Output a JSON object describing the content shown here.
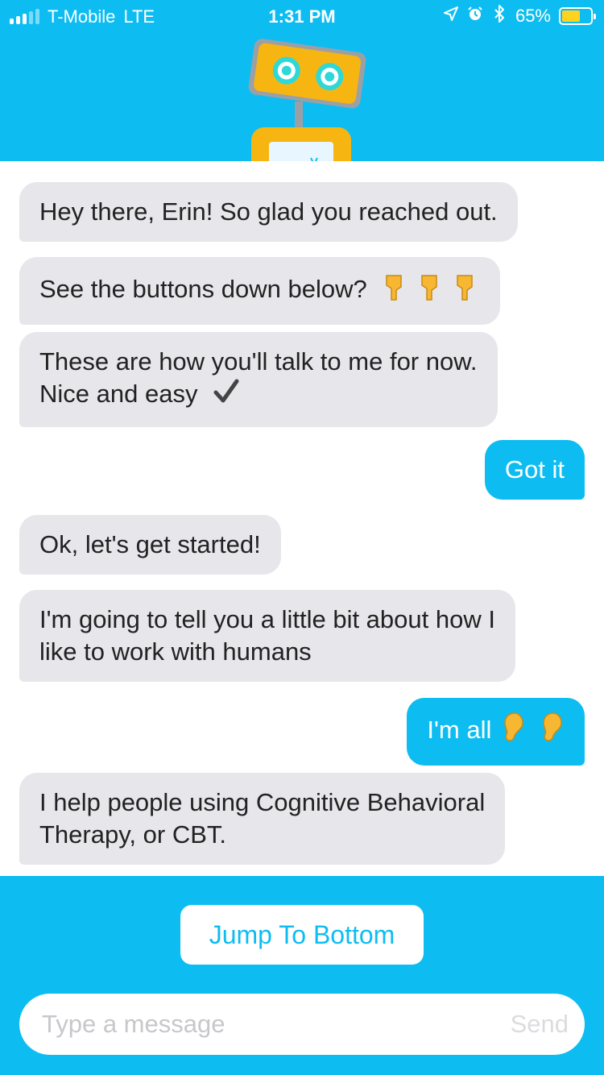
{
  "status_bar": {
    "carrier": "T-Mobile",
    "network": "LTE",
    "time": "1:31 PM",
    "battery": "65%",
    "battery_level": 0.65,
    "icons": [
      "signal-icon",
      "location-arrow-icon",
      "alarm-icon",
      "bluetooth-icon",
      "battery-icon"
    ]
  },
  "header": {
    "mascot": "robot-mascot"
  },
  "colors": {
    "brand": "#0dbdf2",
    "bot_bubble": "#e6e6eb",
    "user_bubble": "#0dbdf2",
    "battery_fill": "#ffd21f",
    "robot_body": "#f7b512",
    "robot_eye": "#2ed8d8"
  },
  "messages": [
    {
      "from": "bot",
      "text": "Hey there, Erin! So glad you reached out."
    },
    {
      "from": "bot",
      "text": "See the buttons down below?",
      "emoji": "pointing-down-hand-icons"
    },
    {
      "from": "bot",
      "line1": "These are how you'll talk to me for now.",
      "line2": "Nice and easy",
      "emoji": "check-mark-icon"
    },
    {
      "from": "user",
      "text": "Got it"
    },
    {
      "from": "bot",
      "text": "Ok, let's get started!"
    },
    {
      "from": "bot",
      "line1": "I'm going to tell you a little bit about how I",
      "line2": "like to work with humans"
    },
    {
      "from": "user",
      "text": "I'm all",
      "emoji": "ear-icons"
    },
    {
      "from": "bot",
      "line1": "I help people using Cognitive Behavioral",
      "line2": "Therapy, or CBT."
    }
  ],
  "footer": {
    "jump_label": "Jump To Bottom",
    "input_placeholder": "Type a message",
    "input_value": "",
    "send_label": "Send"
  }
}
